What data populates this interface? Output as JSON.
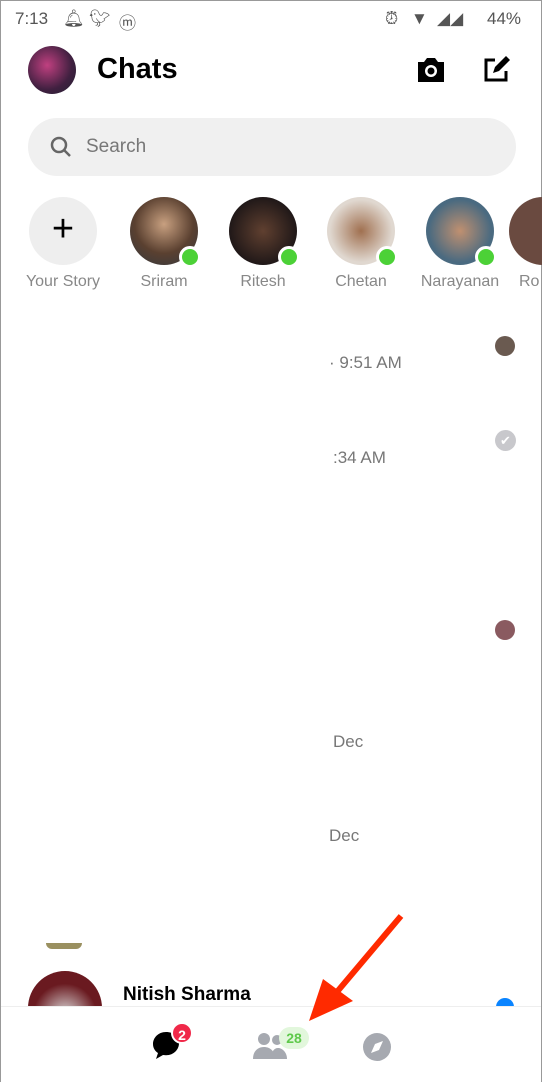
{
  "status_bar": {
    "time": "7:13",
    "battery": "44%"
  },
  "header": {
    "title": "Chats"
  },
  "search": {
    "placeholder": "Search"
  },
  "stories": [
    {
      "name": "Your Story"
    },
    {
      "name": "Sriram",
      "online": true
    },
    {
      "name": "Ritesh",
      "online": true
    },
    {
      "name": "Chetan",
      "online": true
    },
    {
      "name": "Narayanan",
      "online": true
    },
    {
      "name": "Ro"
    }
  ],
  "chat_fragments": [
    "· 9:51 AM",
    ":34 AM",
    "Dec",
    "Dec"
  ],
  "visible_chat": {
    "name": "Nitish Sharma"
  },
  "bottom_nav": {
    "chats_badge": "2",
    "people_badge": "28"
  },
  "colors": {
    "online": "#4cd137",
    "badge_red": "#f02849",
    "badge_green": "#5ec94a",
    "arrow": "#ff2a00",
    "unread_dot": "#0a84ff"
  }
}
